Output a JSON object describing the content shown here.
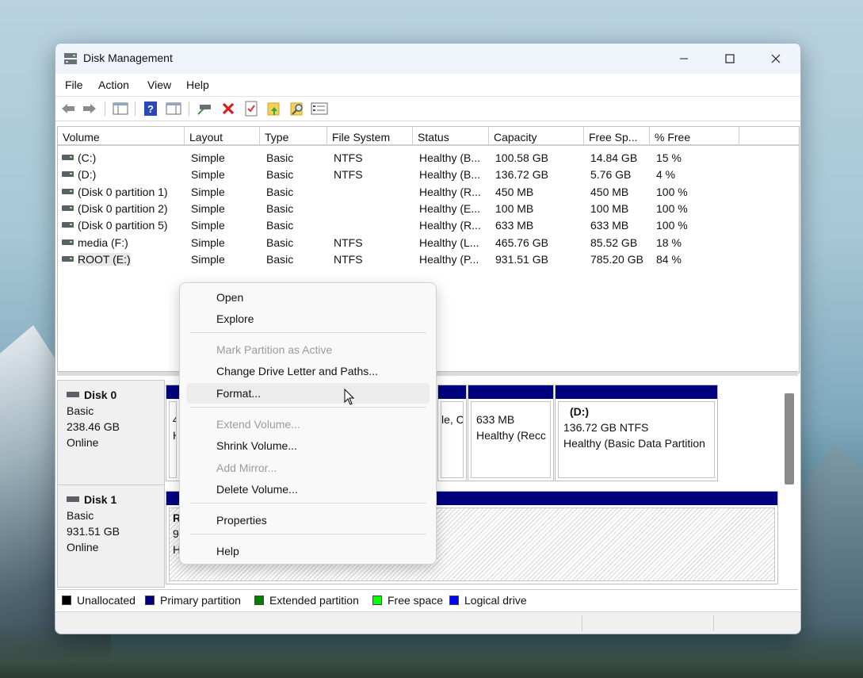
{
  "window": {
    "title": "Disk Management"
  },
  "menu": [
    "File",
    "Action",
    "View",
    "Help"
  ],
  "toolbar_icons": [
    "back-arrow-icon",
    "forward-arrow-icon",
    "console-tree-icon",
    "help-icon",
    "action-pane-icon",
    "connect-drive-icon",
    "delete-icon",
    "check-icon",
    "folder-up-icon",
    "search-folder-icon",
    "properties-list-icon"
  ],
  "columns": [
    "Volume",
    "Layout",
    "Type",
    "File System",
    "Status",
    "Capacity",
    "Free Sp...",
    "% Free"
  ],
  "volumes": [
    [
      "(C:)",
      "Simple",
      "Basic",
      "NTFS",
      "Healthy (B...",
      "100.58 GB",
      "14.84 GB",
      "15 %"
    ],
    [
      "(D:)",
      "Simple",
      "Basic",
      "NTFS",
      "Healthy (B...",
      "136.72 GB",
      "5.76 GB",
      "4 %"
    ],
    [
      "(Disk 0 partition 1)",
      "Simple",
      "Basic",
      "",
      "Healthy (R...",
      "450 MB",
      "450 MB",
      "100 %"
    ],
    [
      "(Disk 0 partition 2)",
      "Simple",
      "Basic",
      "",
      "Healthy (E...",
      "100 MB",
      "100 MB",
      "100 %"
    ],
    [
      "(Disk 0 partition 5)",
      "Simple",
      "Basic",
      "",
      "Healthy (R...",
      "633 MB",
      "633 MB",
      "100 %"
    ],
    [
      "media (F:)",
      "Simple",
      "Basic",
      "NTFS",
      "Healthy (L...",
      "465.76 GB",
      "85.52 GB",
      "18 %"
    ],
    [
      "ROOT (E:)",
      "Simple",
      "Basic",
      "NTFS",
      "Healthy (P...",
      "931.51 GB",
      "785.20 GB",
      "84 %"
    ]
  ],
  "disks": [
    {
      "name": "Disk 0",
      "type": "Basic",
      "size": "238.46 GB",
      "status": "Online",
      "partitions": [
        {
          "line1": "4",
          "line2": "H",
          "line3": ""
        },
        {
          "line1": "",
          "line2": "le, Cr",
          "line3": ""
        },
        {
          "line1": "633 MB",
          "line2": "Healthy (Recc",
          "line3": ""
        },
        {
          "title": "(D:)",
          "line1": "136.72 GB NTFS",
          "line2": "Healthy (Basic Data Partition"
        }
      ]
    },
    {
      "name": "Disk 1",
      "type": "Basic",
      "size": "931.51 GB",
      "status": "Online",
      "partitions": [
        {
          "line1": "R",
          "line2": "9",
          "line3": "H"
        }
      ]
    }
  ],
  "legend": [
    {
      "label": "Unallocated",
      "color": "#000000"
    },
    {
      "label": "Primary partition",
      "color": "#00007f"
    },
    {
      "label": "Extended partition",
      "color": "#007f00"
    },
    {
      "label": "Free space",
      "color": "#00ff00"
    },
    {
      "label": "Logical drive",
      "color": "#0000ff"
    }
  ],
  "context_menu": [
    {
      "label": "Open",
      "enabled": true
    },
    {
      "label": "Explore",
      "enabled": true
    },
    {
      "label": "Mark Partition as Active",
      "enabled": false
    },
    {
      "label": "Change Drive Letter and Paths...",
      "enabled": true
    },
    {
      "label": "Format...",
      "enabled": true,
      "hovered": true
    },
    {
      "label": "Extend Volume...",
      "enabled": false
    },
    {
      "label": "Shrink Volume...",
      "enabled": true
    },
    {
      "label": "Add Mirror...",
      "enabled": false
    },
    {
      "label": "Delete Volume...",
      "enabled": true
    },
    {
      "label": "Properties",
      "enabled": true
    },
    {
      "label": "Help",
      "enabled": true
    }
  ]
}
